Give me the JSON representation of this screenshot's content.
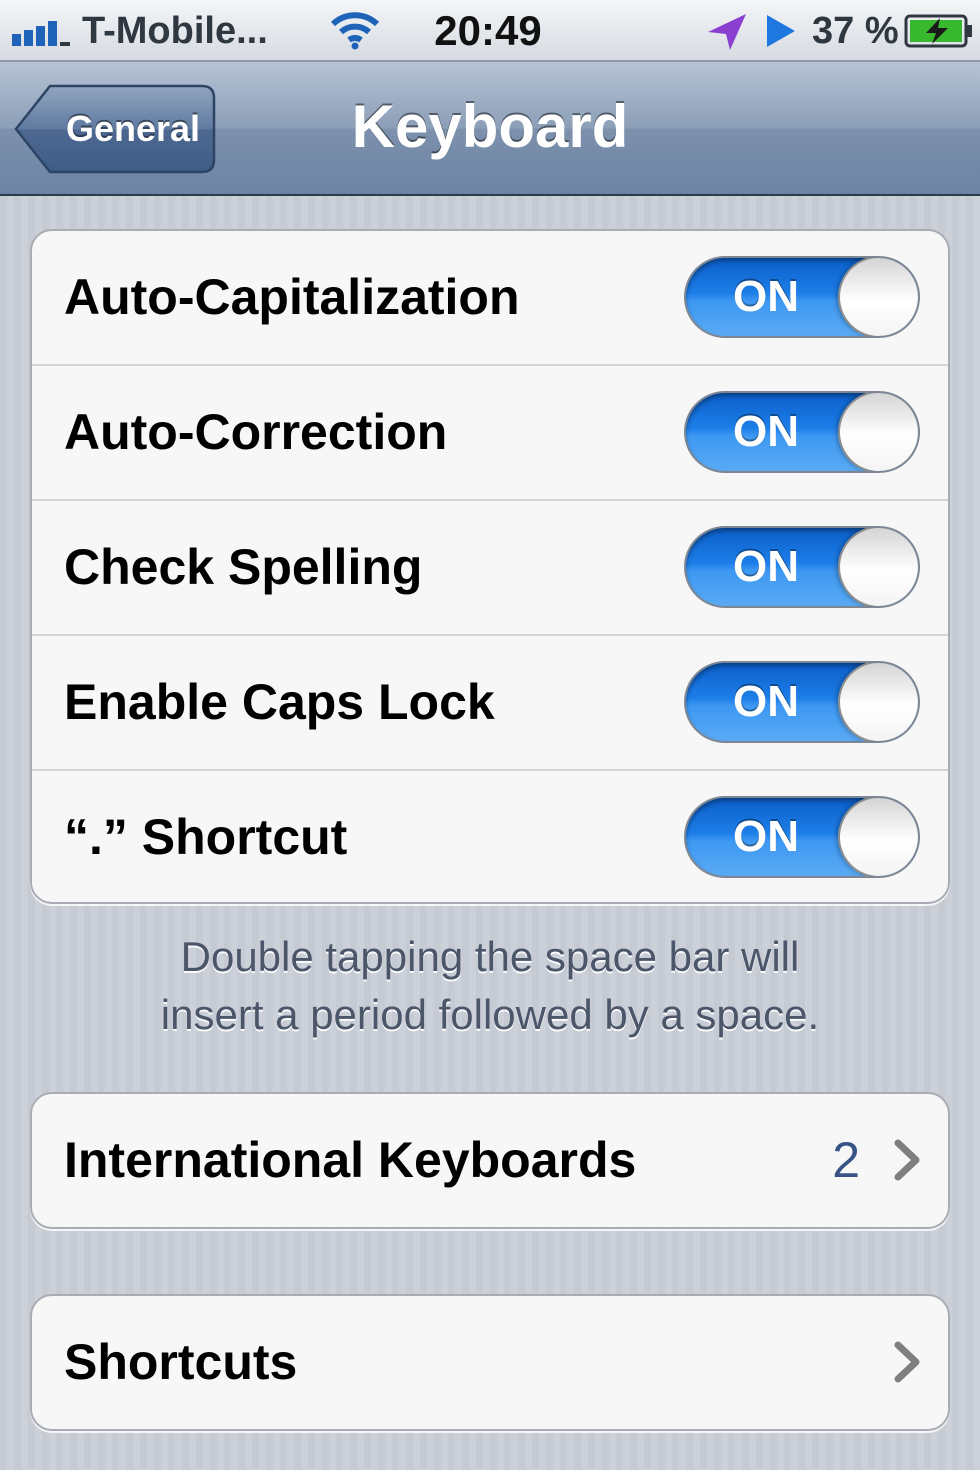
{
  "status_bar": {
    "carrier": "T-Mobile...",
    "time": "20:49",
    "battery_percent": "37 %",
    "icons": [
      "signal-icon",
      "wifi-icon",
      "location-icon",
      "play-icon",
      "battery-charging-icon"
    ]
  },
  "nav_bar": {
    "back_label": "General",
    "title": "Keyboard"
  },
  "toggles": {
    "auto_capitalization": {
      "label": "Auto-Capitalization",
      "state": "ON"
    },
    "auto_correction": {
      "label": "Auto-Correction",
      "state": "ON"
    },
    "check_spelling": {
      "label": "Check Spelling",
      "state": "ON"
    },
    "caps_lock": {
      "label": "Enable Caps Lock",
      "state": "ON"
    },
    "period_shortcut": {
      "label": "“.” Shortcut",
      "state": "ON"
    }
  },
  "footer": {
    "line1": "Double tapping the space bar will",
    "line2": "insert a period followed by a space."
  },
  "international": {
    "label": "International Keyboards",
    "value": "2"
  },
  "shortcuts": {
    "label": "Shortcuts"
  },
  "colors": {
    "toggle_on": "#1d7ee8",
    "nav_bar": "#8c9fb8",
    "detail_value": "#385487"
  }
}
